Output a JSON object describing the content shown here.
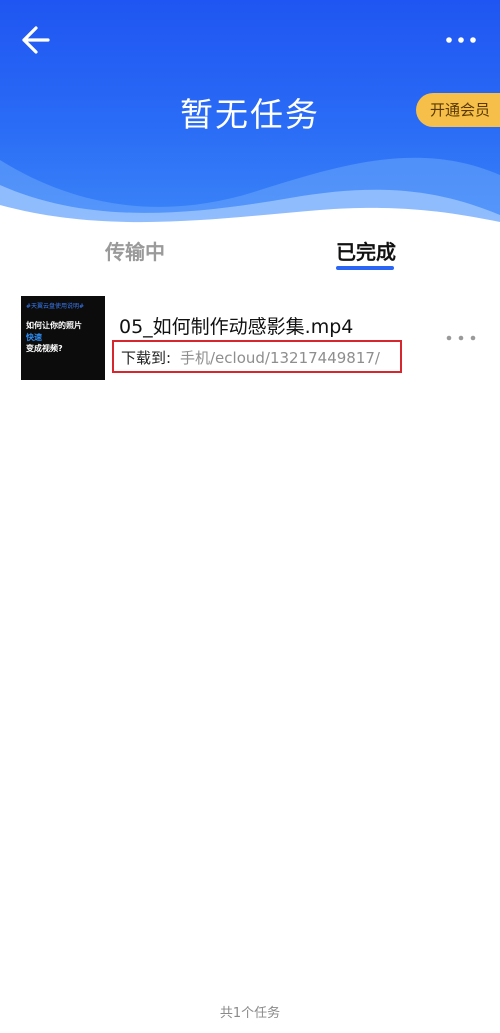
{
  "header": {
    "title": "暂无任务",
    "vip_label": "开通会员",
    "back_icon": "arrow-left-icon",
    "more_icon": "more-horizontal-icon",
    "bg_color": "#1f55f2"
  },
  "tabs": [
    {
      "label": "传输中",
      "active": false
    },
    {
      "label": "已完成",
      "active": true
    }
  ],
  "tasks": [
    {
      "file_name": "05_如何制作动感影集.mp4",
      "path_label": "下载到:",
      "path_value": "手机/ecloud/13217449817/",
      "thumbnail_text": [
        "#天翼云盘使用说明#",
        "如何让你的照片",
        "快速",
        "变成视频?"
      ]
    }
  ],
  "footer": {
    "count_text": "共1个任务"
  },
  "colors": {
    "accent": "#2a66f3",
    "vip": "#f6bf4a",
    "highlight_box": "#d6272e"
  }
}
